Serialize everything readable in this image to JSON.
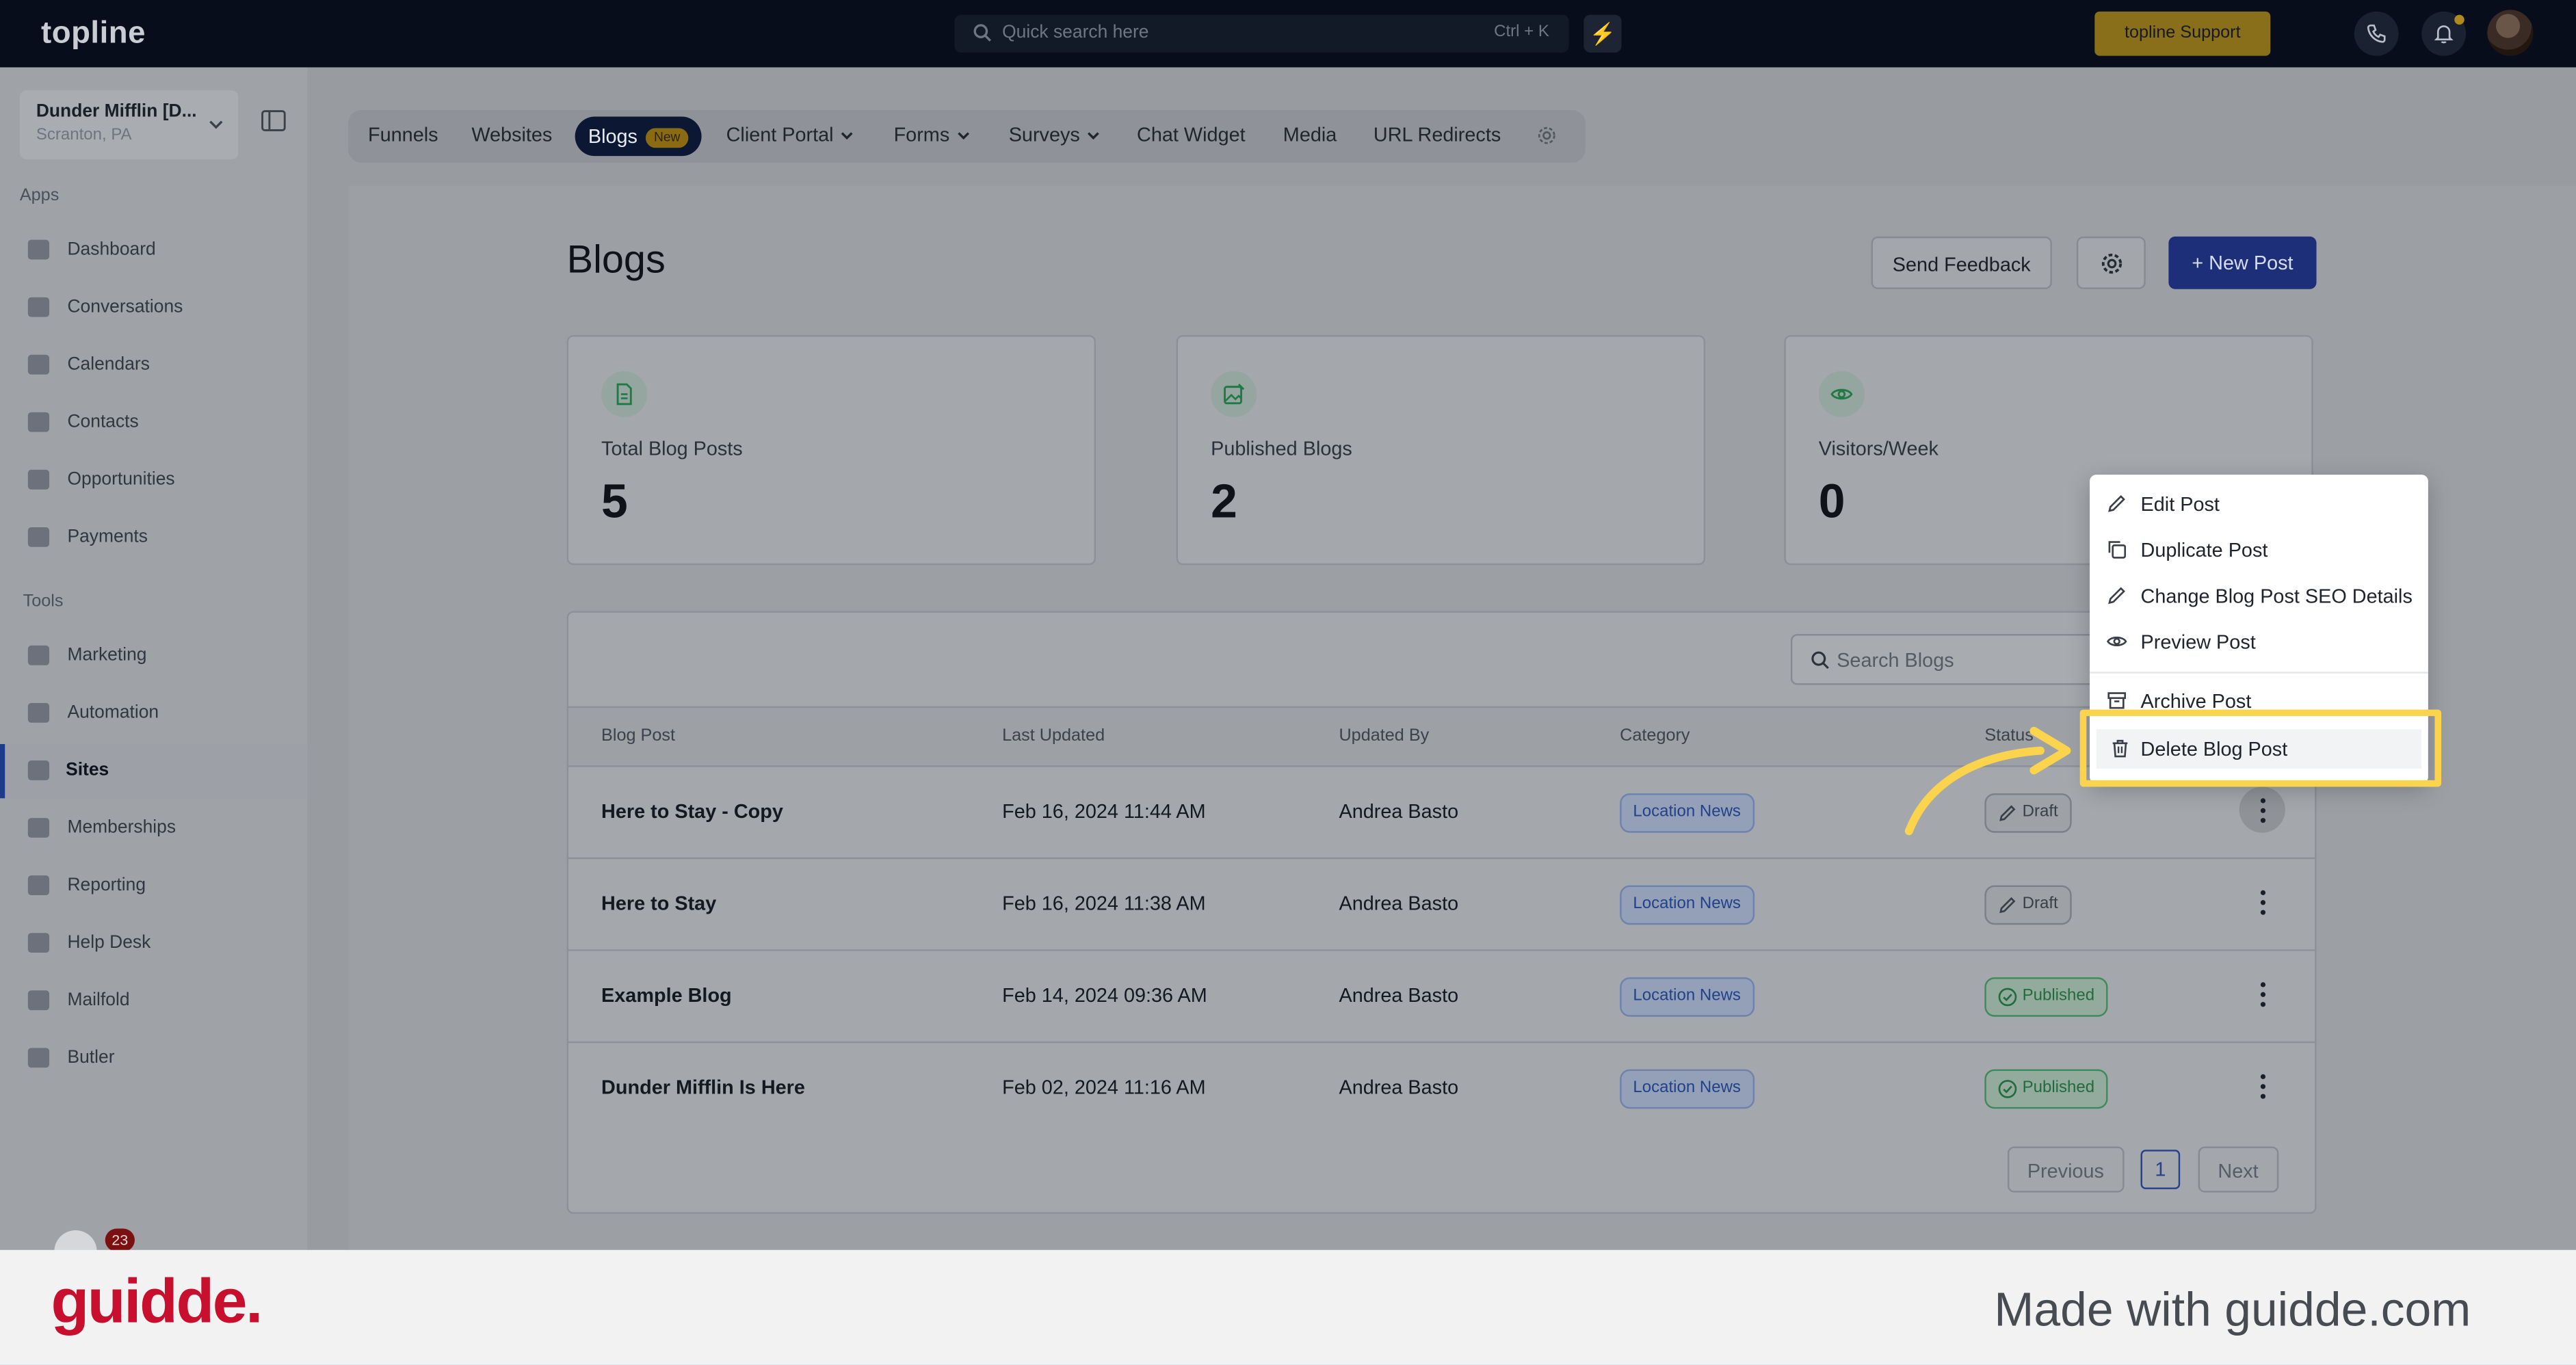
{
  "topbar": {
    "logo": "topline",
    "search_placeholder": "Quick search here",
    "search_shortcut": "Ctrl + K",
    "support_label": "topline Support"
  },
  "sidebar": {
    "account_name": "Dunder Mifflin [D...",
    "account_location": "Scranton, PA",
    "apps_heading": "Apps",
    "apps": [
      "Dashboard",
      "Conversations",
      "Calendars",
      "Contacts",
      "Opportunities",
      "Payments"
    ],
    "tools_heading": "Tools",
    "tools": [
      "Marketing",
      "Automation",
      "Sites",
      "Memberships",
      "Reporting",
      "Help Desk",
      "Mailfold",
      "Butler"
    ],
    "active_item": "Sites",
    "notification_count": "23"
  },
  "tabs": [
    {
      "label": "Funnels"
    },
    {
      "label": "Websites"
    },
    {
      "label": "Blogs",
      "badge": "New"
    },
    {
      "label": "Client Portal"
    },
    {
      "label": "Forms"
    },
    {
      "label": "Surveys"
    },
    {
      "label": "Chat Widget"
    },
    {
      "label": "Media"
    },
    {
      "label": "URL Redirects"
    }
  ],
  "page": {
    "title": "Blogs",
    "feedback_label": "Send Feedback",
    "new_post_label": "+ New Post"
  },
  "stats": [
    {
      "label": "Total Blog Posts",
      "value": "5"
    },
    {
      "label": "Published Blogs",
      "value": "2"
    },
    {
      "label": "Visitors/Week",
      "value": "0"
    }
  ],
  "table": {
    "search_placeholder": "Search Blogs",
    "headers": [
      "Blog Post",
      "Last Updated",
      "Updated By",
      "Category",
      "Status"
    ],
    "rows": [
      {
        "title": "Here to Stay - Copy",
        "updated": "Feb 16, 2024 11:44 AM",
        "by": "Andrea Basto",
        "category": "Location News",
        "status": "Draft"
      },
      {
        "title": "Here to Stay",
        "updated": "Feb 16, 2024 11:38 AM",
        "by": "Andrea Basto",
        "category": "Location News",
        "status": "Draft"
      },
      {
        "title": "Example Blog",
        "updated": "Feb 14, 2024 09:36 AM",
        "by": "Andrea Basto",
        "category": "Location News",
        "status": "Published"
      },
      {
        "title": "Dunder Mifflin Is Here",
        "updated": "Feb 02, 2024 11:16 AM",
        "by": "Andrea Basto",
        "category": "Location News",
        "status": "Published"
      }
    ],
    "pagination": {
      "previous": "Previous",
      "page": "1",
      "next": "Next"
    }
  },
  "menu": {
    "items": [
      "Edit Post",
      "Duplicate Post",
      "Change Blog Post SEO Details",
      "Preview Post",
      "Archive Post",
      "Delete Blog Post"
    ],
    "highlighted": "Delete Blog Post"
  },
  "footer": {
    "brand": "guidde.",
    "made_with": "Made with guidde.com"
  },
  "colors": {
    "accent": "#1e2f7a",
    "brand_red": "#c8102e",
    "highlight_yellow": "#fbd34d",
    "published_green": "#216b3d"
  }
}
